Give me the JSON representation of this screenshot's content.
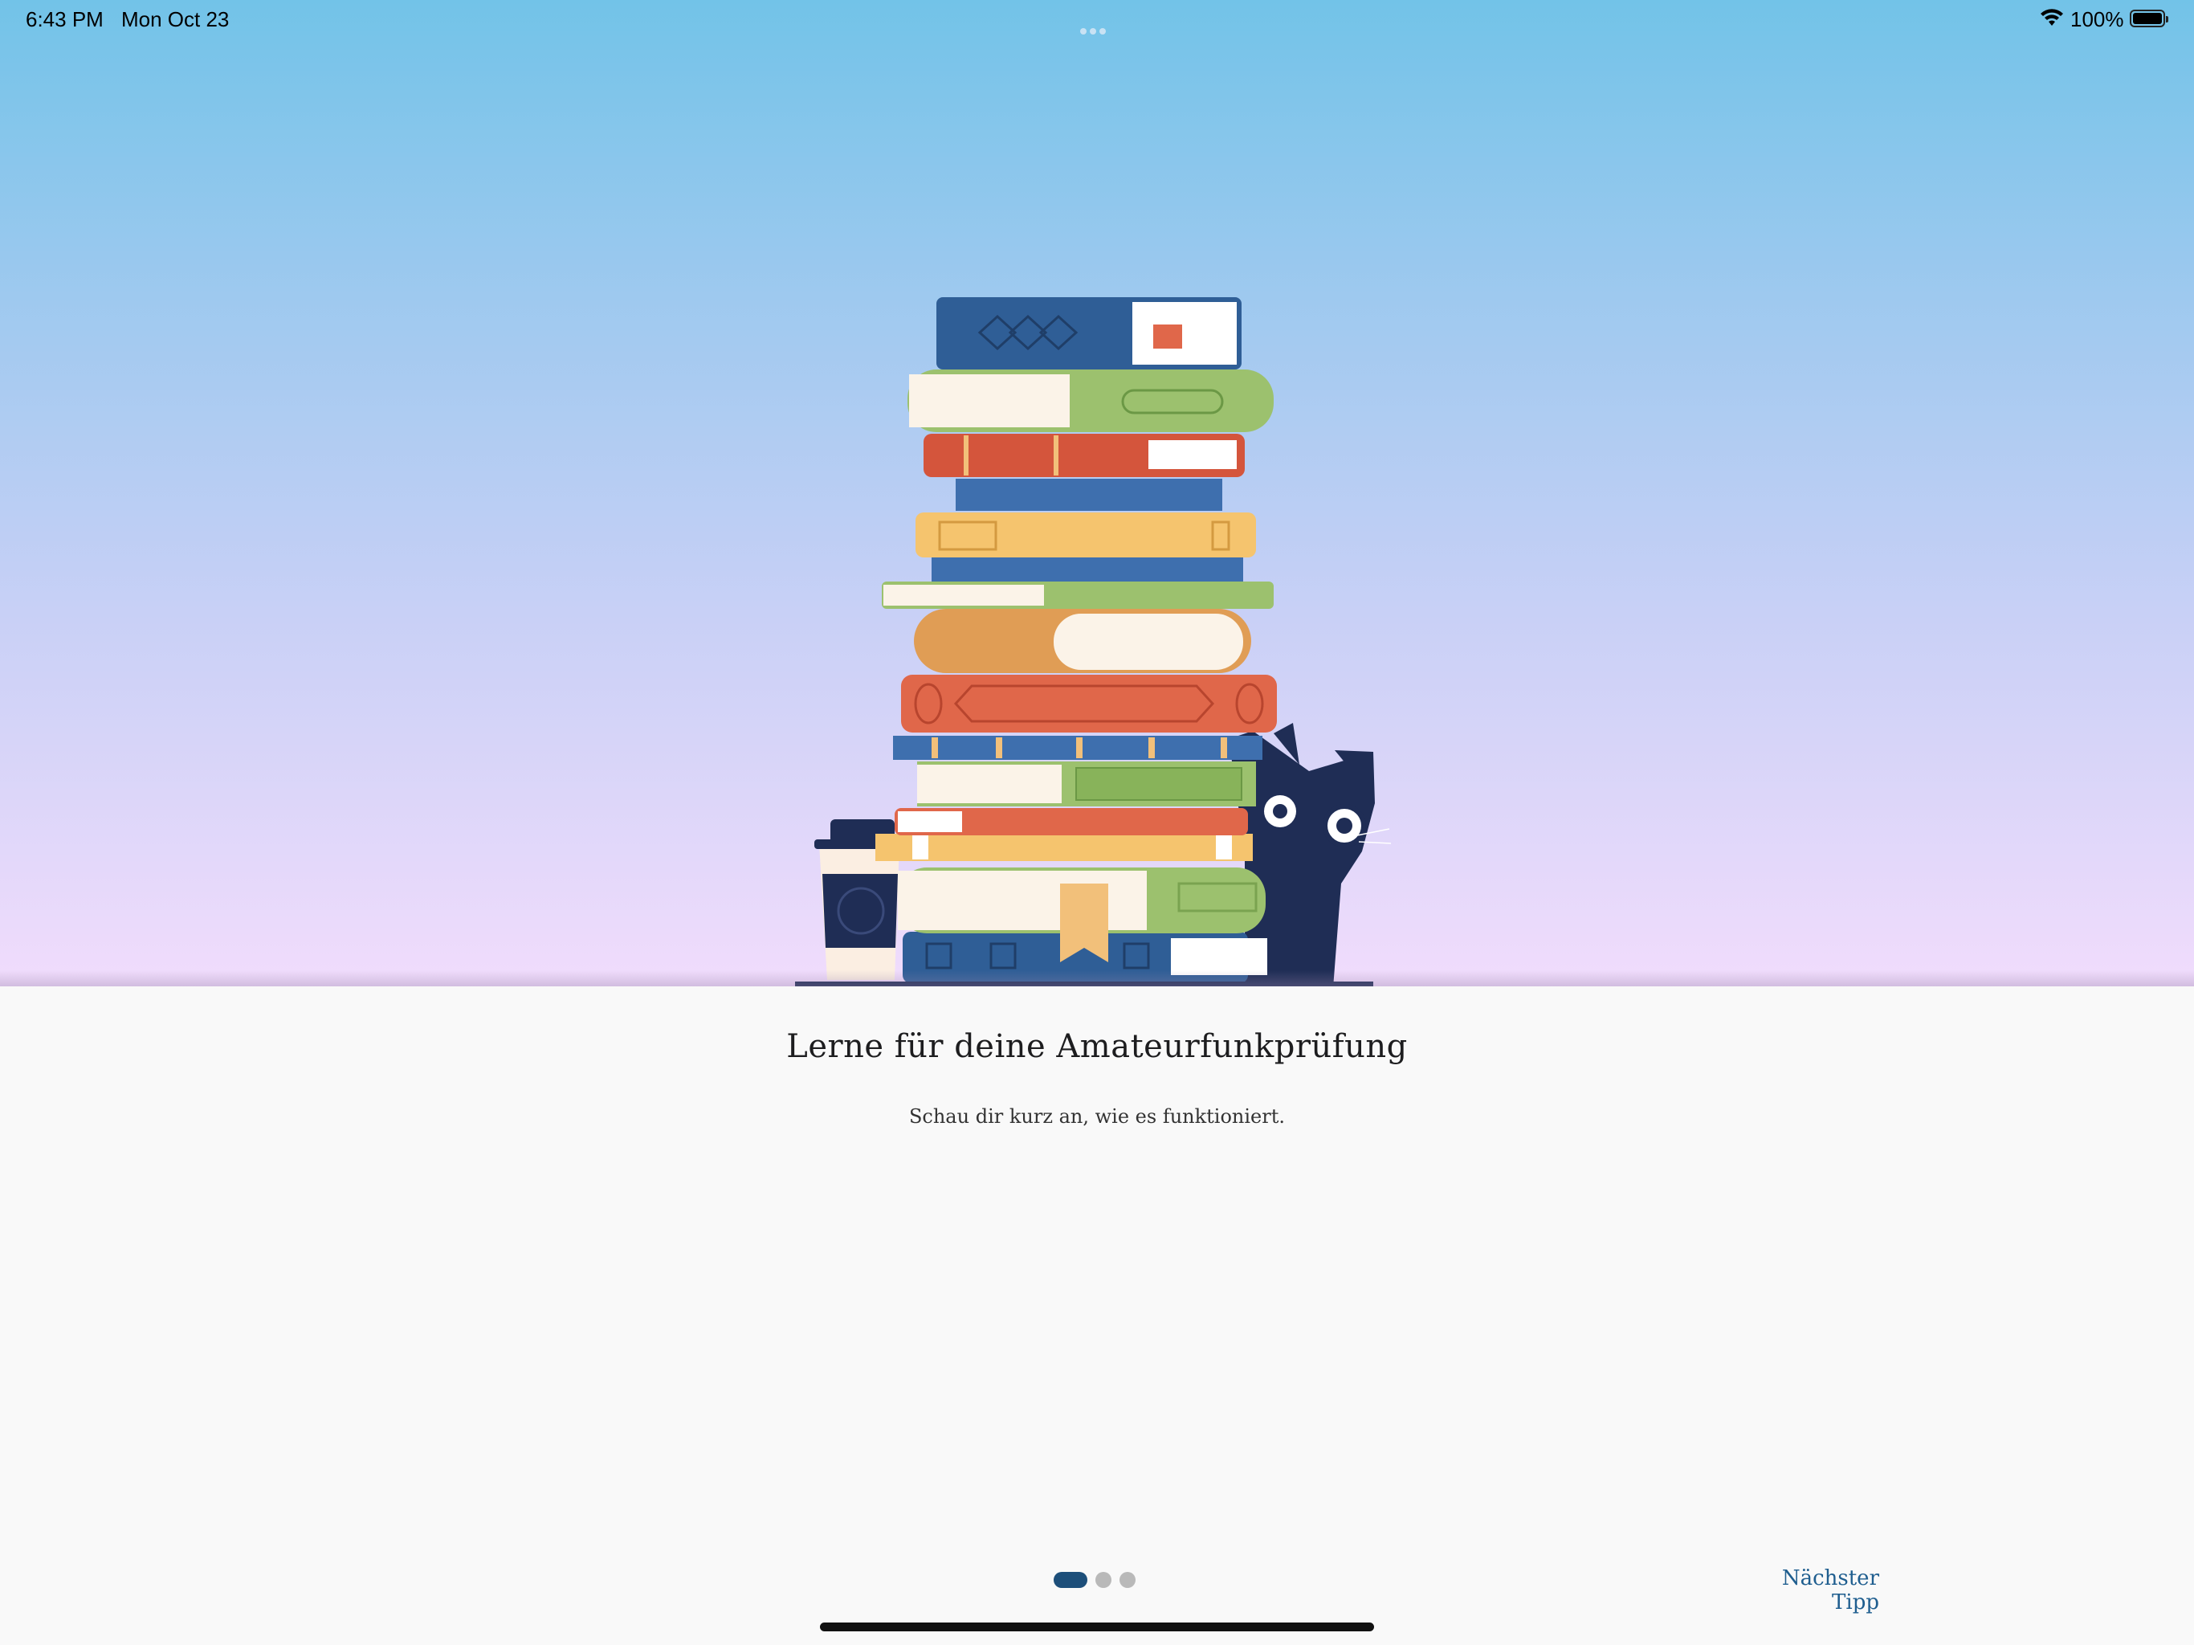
{
  "status_bar": {
    "time": "6:43 PM",
    "date": "Mon Oct 23",
    "battery": "100%",
    "icons": [
      "wifi-icon",
      "battery-icon",
      "multitasking-dots-icon"
    ]
  },
  "hero": {
    "illustration": "stack-of-books-with-cat",
    "colors": {
      "sky_top": "#72c3e8",
      "sky_bottom": "#f1dcfc"
    }
  },
  "onboarding": {
    "title": "Lerne für deine Amateurfunkprüfung",
    "subtitle": "Schau dir kurz an, wie es funktioniert.",
    "pages_total": 3,
    "current_page": 1,
    "next_label": "Nächster Tipp"
  },
  "colors": {
    "accent": "#1f5e8f",
    "pager_active": "#1d4f7a",
    "pager_inactive": "#b9b9b9"
  }
}
